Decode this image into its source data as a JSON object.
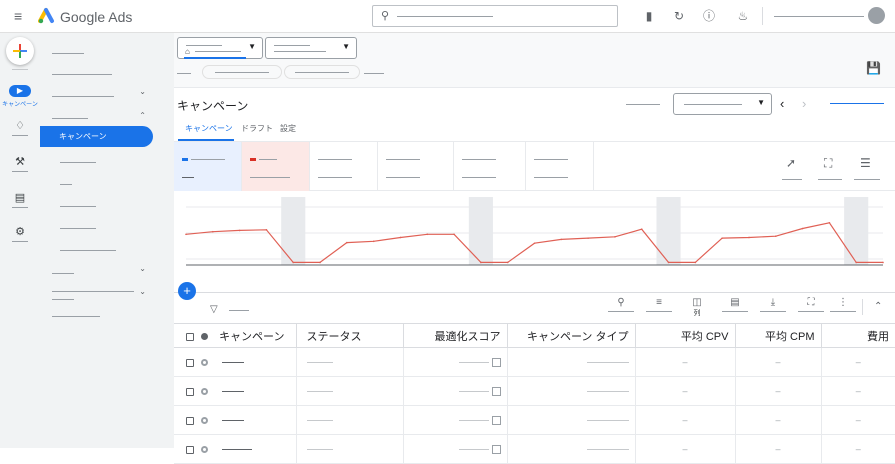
{
  "app": {
    "name": "Google Ads"
  },
  "rail": {
    "active_label": "キャンペーン"
  },
  "nav": {
    "selected_label": "キャンペーン"
  },
  "page": {
    "title": "キャンペーン"
  },
  "tabs": [
    {
      "label": "キャンペーン"
    },
    {
      "label": "ドラフト"
    },
    {
      "label": "設定"
    }
  ],
  "toolbar": {
    "columns_label": "列"
  },
  "table": {
    "headers": [
      "キャンペーン",
      "ステータス",
      "最適化スコア",
      "キャンペーン タイプ",
      "平均 CPV",
      "平均 CPM",
      "費用"
    ],
    "rows": [
      {
        "cpv": "–",
        "cpm": "–",
        "cost": "–"
      },
      {
        "cpv": "–",
        "cpm": "–",
        "cost": "–"
      },
      {
        "cpv": "–",
        "cpm": "–",
        "cost": "–"
      },
      {
        "cpv": "–",
        "cpm": "–",
        "cost": "–"
      }
    ]
  },
  "icons": {
    "menu": "hamburger-icon",
    "search": "search-icon",
    "reports": "reports-icon",
    "refresh": "refresh-icon",
    "help": "help-icon",
    "notifications": "bell-icon",
    "save": "save-icon",
    "trend": "trend-icon",
    "expand": "expand-icon",
    "adjust": "adjust-icon",
    "filter": "filter-icon",
    "columns": "columns-icon",
    "download": "download-icon",
    "more": "more-vert-icon"
  },
  "colors": {
    "accent": "#1a73e8",
    "series_line": "#e06055",
    "card_selected_blue": "#e8f0fe",
    "card_selected_red": "#fce8e6"
  },
  "chart_data": {
    "type": "line",
    "series": [
      {
        "values": [
          48,
          52,
          54,
          55,
          4,
          4,
          35,
          37,
          43,
          48,
          48,
          4,
          4,
          34,
          40,
          42,
          44,
          56,
          4,
          4,
          42,
          43,
          45,
          57,
          66,
          4,
          4
        ]
      }
    ],
    "ylim": [
      0,
      100
    ],
    "grid": true,
    "shaded_bands": [
      [
        4,
        5
      ],
      [
        11,
        12
      ],
      [
        18,
        19
      ],
      [
        25,
        26
      ]
    ]
  }
}
